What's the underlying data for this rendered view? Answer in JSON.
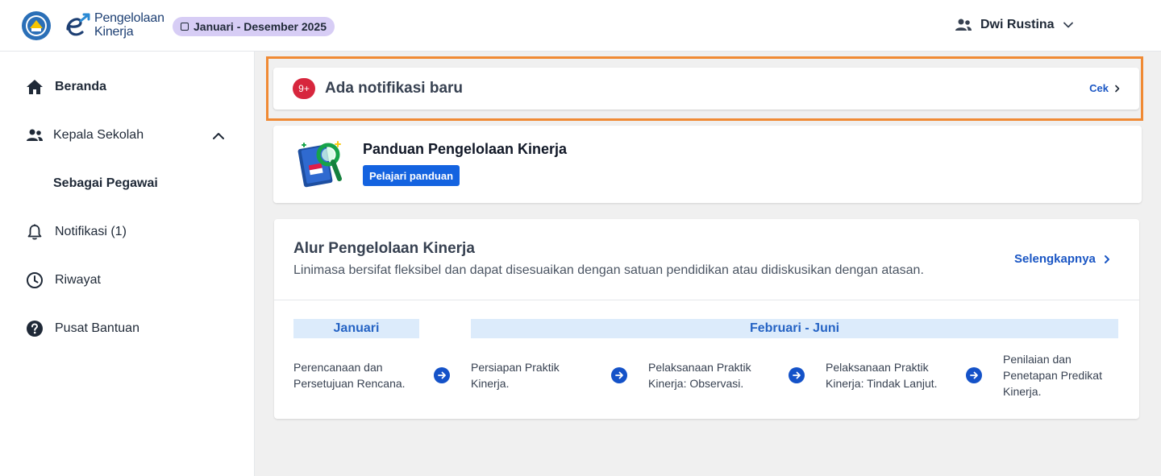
{
  "header": {
    "brand_line1": "Pengelolaan",
    "brand_line2": "Kinerja",
    "period": "Januari - Desember 2025",
    "user_name": "Dwi Rustina"
  },
  "sidebar": {
    "items": [
      {
        "label": "Beranda",
        "icon": "home-icon"
      },
      {
        "label": "Kepala Sekolah",
        "icon": "people-icon"
      },
      {
        "label": "Sebagai Pegawai"
      },
      {
        "label": "Notifikasi (1)",
        "icon": "bell-icon"
      },
      {
        "label": "Riwayat",
        "icon": "clock-icon"
      },
      {
        "label": "Pusat Bantuan",
        "icon": "help-icon"
      }
    ]
  },
  "notification": {
    "badge": "9+",
    "text": "Ada notifikasi baru",
    "link": "Cek"
  },
  "guide": {
    "title": "Panduan Pengelolaan Kinerja",
    "button": "Pelajari panduan"
  },
  "flow": {
    "title": "Alur Pengelolaan Kinerja",
    "subtitle": "Linimasa bersifat fleksibel dan dapat disesuaikan dengan satuan pendidikan atau didiskusikan dengan atasan.",
    "more": "Selengkapnya",
    "phases": [
      "Januari",
      "Februari - Juni"
    ],
    "steps": [
      {
        "line1": "Perencanaan dan",
        "line2": "Persetujuan Rencana."
      },
      {
        "line1": "Persiapan Praktik",
        "line2": "Kinerja."
      },
      {
        "line1": "Pelaksanaan Praktik",
        "line2": "Kinerja: Observasi."
      },
      {
        "line1": "Pelaksanaan Praktik",
        "line2": "Kinerja: Tindak Lanjut."
      },
      {
        "line1": "Penilaian dan",
        "line2": "Penetapan Predikat",
        "line3": "Kinerja."
      }
    ]
  },
  "colors": {
    "accent_blue": "#1463e0",
    "highlight_orange": "#f08a34",
    "badge_red": "#d7263d",
    "pill_purple": "#d7cdf5"
  }
}
